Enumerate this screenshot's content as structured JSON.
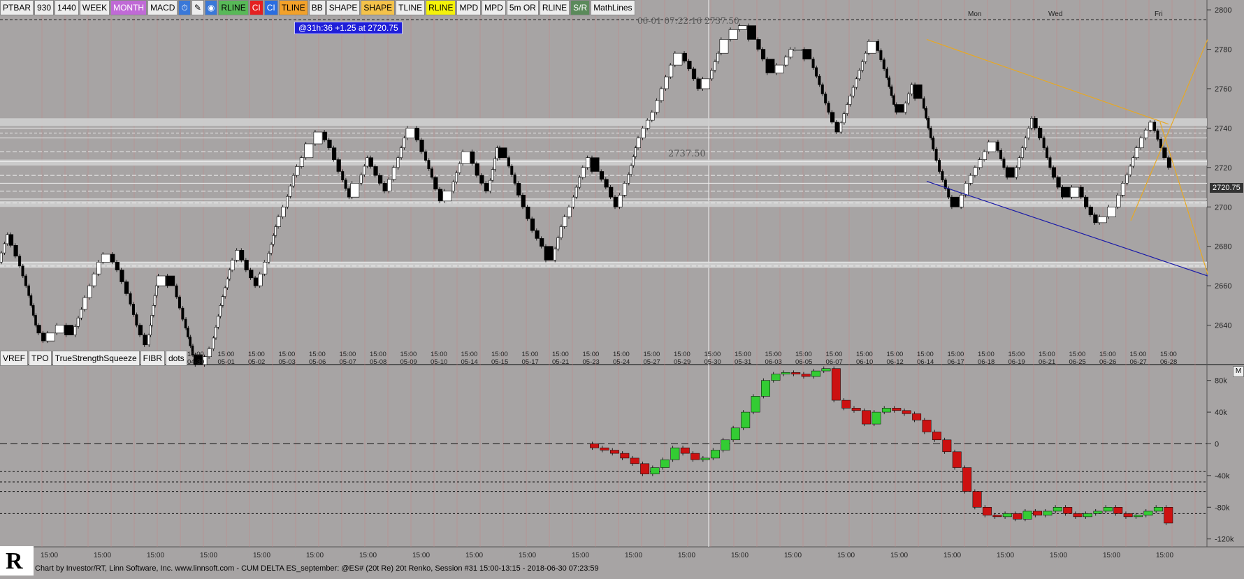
{
  "toolbar": [
    {
      "label": "PTBAR",
      "bg": "#ededed",
      "fg": "#000"
    },
    {
      "label": "930",
      "bg": "#ededed",
      "fg": "#000"
    },
    {
      "label": "1440",
      "bg": "#ededed",
      "fg": "#000"
    },
    {
      "label": "WEEK",
      "bg": "#ededed",
      "fg": "#000"
    },
    {
      "label": "MONTH",
      "bg": "#c06ad6",
      "fg": "#fff"
    },
    {
      "label": "MACD",
      "bg": "#ededed",
      "fg": "#000"
    },
    {
      "label": "⏱",
      "bg": "#3a78d8",
      "fg": "#fff",
      "icon": "clock-icon"
    },
    {
      "label": "✎",
      "bg": "#ededed",
      "fg": "#000",
      "icon": "pencil-icon"
    },
    {
      "label": "◉",
      "bg": "#3a78d8",
      "fg": "#fff",
      "icon": "palette-icon"
    },
    {
      "label": "RLINE",
      "bg": "#58b958",
      "fg": "#000"
    },
    {
      "label": "CI",
      "bg": "#e42020",
      "fg": "#fff"
    },
    {
      "label": "CI",
      "bg": "#2a6de0",
      "fg": "#fff"
    },
    {
      "label": "TLINE",
      "bg": "#f2a12a",
      "fg": "#000"
    },
    {
      "label": "BB",
      "bg": "#ededed",
      "fg": "#000"
    },
    {
      "label": "SHAPE",
      "bg": "#ededed",
      "fg": "#000"
    },
    {
      "label": "SHAPE",
      "bg": "#f4c24a",
      "fg": "#000"
    },
    {
      "label": "TLINE",
      "bg": "#ededed",
      "fg": "#000"
    },
    {
      "label": "RLINE",
      "bg": "#f5f20a",
      "fg": "#000"
    },
    {
      "label": "MPD",
      "bg": "#ededed",
      "fg": "#000"
    },
    {
      "label": "MPD",
      "bg": "#ededed",
      "fg": "#000"
    },
    {
      "label": "5m OR",
      "bg": "#ededed",
      "fg": "#000"
    },
    {
      "label": "RLINE",
      "bg": "#ededed",
      "fg": "#000"
    },
    {
      "label": "S/R",
      "bg": "#5b8a5b",
      "fg": "#fff"
    },
    {
      "label": "MathLines",
      "bg": "#ededed",
      "fg": "#000"
    }
  ],
  "toolbar2": [
    {
      "label": "VREF"
    },
    {
      "label": "TPO"
    },
    {
      "label": "TrueStrengthSqueeze"
    },
    {
      "label": "FIBR"
    },
    {
      "label": "dots"
    }
  ],
  "header": {
    "datetime": "06-01 07:22:16",
    "price": "2737.50"
  },
  "badge": "@31h:36  +1.25 at 2720.75",
  "price_tag": "2720.75",
  "level_label": "2737.50",
  "m_label": "M",
  "footer": "Chart by Investor/RT, Linn Software, Inc. www.linnsoft.com - CUM DELTA ES_september: @ES# (20t Re) 20t Renko, Session #31 15:00-13:15 - 2018-06-30 07:23:59",
  "colors": {
    "background": "#a7a4a4",
    "up_candle": "#ffffff",
    "down_candle": "#000000",
    "delta_up": "#33cc33",
    "delta_down": "#cc1111",
    "trend_orange": "#e7a824",
    "trend_blue": "#1a1aa8",
    "grid_red": "#c98383"
  },
  "chart_data": [
    {
      "type": "line",
      "subtype": "renko-candles",
      "ylim": [
        2620,
        2805
      ],
      "y_ticks": [
        2640,
        2660,
        2680,
        2700,
        2720,
        2740,
        2760,
        2780,
        2800
      ],
      "top_labels": [
        "Mon",
        "Wed",
        "Fri"
      ],
      "x_labels": [
        "04-30",
        "05-01",
        "05-02",
        "05-03",
        "05-06",
        "05-07",
        "05-08",
        "05-09",
        "05-10",
        "05-14",
        "05-15",
        "05-17",
        "05-21",
        "05-23",
        "05-24",
        "05-27",
        "05-29",
        "05-30",
        "05-31",
        "06-03",
        "06-05",
        "06-07",
        "06-10",
        "06-12",
        "06-14",
        "06-17",
        "06-18",
        "06-19",
        "06-21",
        "06-25",
        "06-26",
        "06-27",
        "06-28"
      ],
      "time_label": "15:00",
      "horizontal_levels": [
        2795,
        2740,
        2737.5,
        2735,
        2728,
        2723,
        2716,
        2712,
        2708,
        2704,
        2702,
        2672,
        2670
      ],
      "price_path": [
        2672,
        2686,
        2675,
        2660,
        2640,
        2632,
        2636,
        2640,
        2635,
        2648,
        2660,
        2672,
        2676,
        2668,
        2656,
        2640,
        2630,
        2660,
        2665,
        2660,
        2643,
        2625,
        2620,
        2628,
        2650,
        2668,
        2678,
        2668,
        2660,
        2672,
        2690,
        2700,
        2716,
        2725,
        2732,
        2738,
        2730,
        2718,
        2705,
        2712,
        2725,
        2716,
        2708,
        2720,
        2735,
        2740,
        2728,
        2715,
        2703,
        2708,
        2722,
        2728,
        2716,
        2708,
        2730,
        2725,
        2712,
        2700,
        2688,
        2680,
        2673,
        2690,
        2700,
        2715,
        2725,
        2718,
        2710,
        2700,
        2712,
        2730,
        2740,
        2748,
        2760,
        2772,
        2778,
        2770,
        2760,
        2765,
        2778,
        2785,
        2790,
        2792,
        2785,
        2775,
        2768,
        2772,
        2780,
        2780,
        2775,
        2762,
        2748,
        2738,
        2752,
        2765,
        2778,
        2784,
        2770,
        2752,
        2748,
        2762,
        2755,
        2735,
        2718,
        2705,
        2700,
        2712,
        2720,
        2728,
        2733,
        2720,
        2715,
        2730,
        2745,
        2735,
        2720,
        2710,
        2705,
        2710,
        2700,
        2692,
        2695,
        2700,
        2712,
        2725,
        2735,
        2743,
        2730,
        2720
      ],
      "trend_lines": [
        {
          "color": "#e7a824",
          "from": [
            1326,
            2785
          ],
          "to": [
            1672,
            2742
          ]
        },
        {
          "color": "#1a1aa8",
          "from": [
            1326,
            2713
          ],
          "to": [
            1728,
            2665
          ]
        },
        {
          "color": "#e7a824",
          "from": [
            1618,
            2693
          ],
          "to": [
            1728,
            2785
          ]
        },
        {
          "color": "#e7a824",
          "from": [
            1660,
            2743
          ],
          "to": [
            1728,
            2666
          ]
        }
      ]
    },
    {
      "type": "line",
      "subtype": "cumulative-delta",
      "title": "CUM DELTA ES_september",
      "ylim": [
        -130000,
        100000
      ],
      "y_ticks": [
        {
          "v": 80000,
          "l": "80k"
        },
        {
          "v": 40000,
          "l": "40k"
        },
        {
          "v": 0,
          "l": "0"
        },
        {
          "v": -40000,
          "l": "-40k"
        },
        {
          "v": -80000,
          "l": "-80k"
        },
        {
          "v": -120000,
          "l": "-120k"
        }
      ],
      "horizontal_levels": [
        0,
        -35000,
        -48000,
        -60000,
        -88000
      ],
      "delta_path": [
        0,
        -5000,
        -8000,
        -12000,
        -18000,
        -25000,
        -38000,
        -30000,
        -20000,
        -5000,
        -12000,
        -20000,
        -18000,
        -8000,
        5000,
        20000,
        40000,
        60000,
        80000,
        88000,
        90000,
        88000,
        85000,
        92000,
        95000,
        55000,
        45000,
        42000,
        25000,
        40000,
        45000,
        42000,
        38000,
        30000,
        15000,
        5000,
        -10000,
        -30000,
        -60000,
        -80000,
        -90000,
        -92000,
        -88000,
        -95000,
        -85000,
        -90000,
        -85000,
        -80000,
        -88000,
        -92000,
        -88000,
        -85000,
        -80000,
        -88000,
        -92000,
        -90000,
        -85000,
        -80000,
        -100000
      ]
    }
  ]
}
